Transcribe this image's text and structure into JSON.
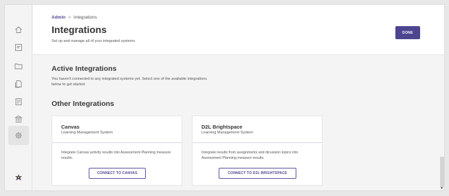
{
  "breadcrumb": {
    "root": "Admin",
    "separator": ">",
    "current": "Integrations"
  },
  "header": {
    "title": "Integrations",
    "subtitle": "Set up and manage all of your integrated systems",
    "done_label": "DONE"
  },
  "active": {
    "title": "Active Integrations",
    "description": "You haven't connected to any integrated systems yet. Select one of the available integrations below to get started."
  },
  "other": {
    "title": "Other Integrations"
  },
  "cards": [
    {
      "title": "Canvas",
      "subtitle": "Learning Management System",
      "description": "Integrate Canvas activity results into Assessment Planning measure results.",
      "button": "CONNECT TO CANVAS"
    },
    {
      "title": "D2L Brightspace",
      "subtitle": "Learning Management System",
      "description": "Integrate results from assignments and dicussion topics into Assessment Planning measure results.",
      "button": "CONNECT TO D2L BRIGHTSPACE"
    }
  ],
  "sidebar": {
    "items": [
      {
        "icon": "home-icon"
      },
      {
        "icon": "dashboard-icon"
      },
      {
        "icon": "folder-icon"
      },
      {
        "icon": "document-icon"
      },
      {
        "icon": "report-icon"
      },
      {
        "icon": "institution-icon"
      },
      {
        "icon": "gear-icon",
        "active": true
      },
      {
        "icon": "logo-icon"
      }
    ]
  },
  "colors": {
    "accent": "#4d4590",
    "background": "#f4f4f4",
    "card": "#ffffff"
  }
}
